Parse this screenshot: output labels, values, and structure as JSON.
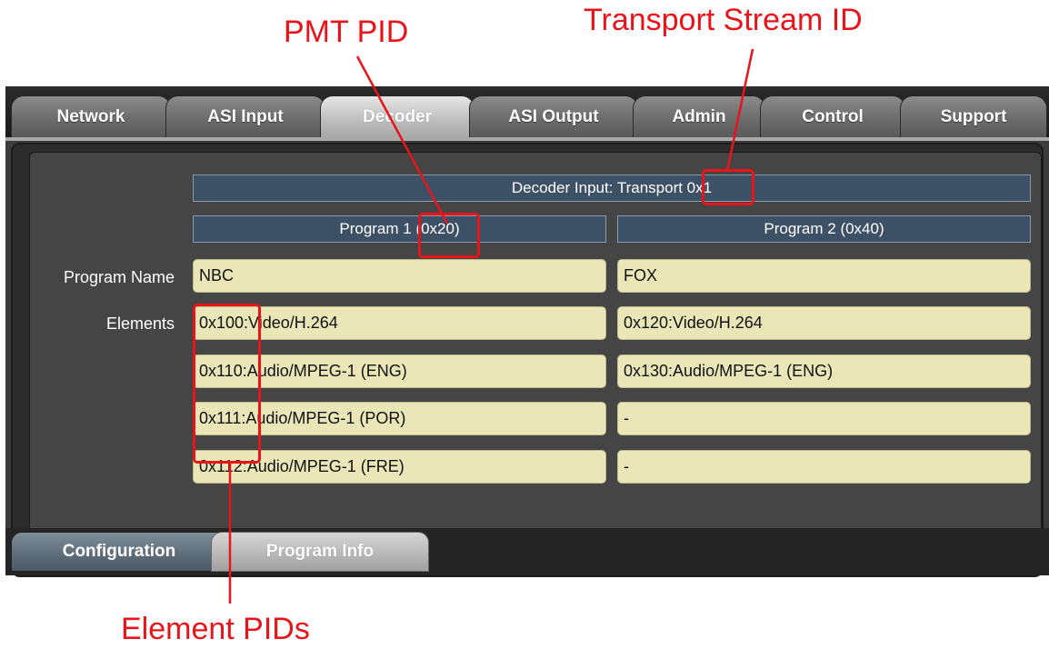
{
  "callouts": {
    "pmt_pid": "PMT PID",
    "transport_stream_id": "Transport Stream ID",
    "element_pids": "Element PIDs"
  },
  "tabs": [
    "Network",
    "ASI Input",
    "Decoder",
    "ASI Output",
    "Admin",
    "Control",
    "Support"
  ],
  "active_tab": "Decoder",
  "decoder_input_header": "Decoder Input: Transport 0x1",
  "programs": [
    {
      "header": "Program 1 (0x20)",
      "name": "NBC",
      "elements": [
        "0x100:Video/H.264",
        "0x110:Audio/MPEG-1 (ENG)",
        "0x111:Audio/MPEG-1 (POR)",
        "0x112:Audio/MPEG-1 (FRE)"
      ]
    },
    {
      "header": "Program 2 (0x40)",
      "name": "FOX",
      "elements": [
        "0x120:Video/H.264",
        "0x130:Audio/MPEG-1 (ENG)",
        "-",
        "-"
      ]
    }
  ],
  "row_labels": {
    "program_name": "Program Name",
    "elements": "Elements"
  },
  "subtabs": [
    "Configuration",
    "Program Info"
  ],
  "active_subtab": "Program Info",
  "colors": {
    "annotation": "#e8141a",
    "header_bg": "#3d5166",
    "field_bg": "#eae6b8"
  }
}
